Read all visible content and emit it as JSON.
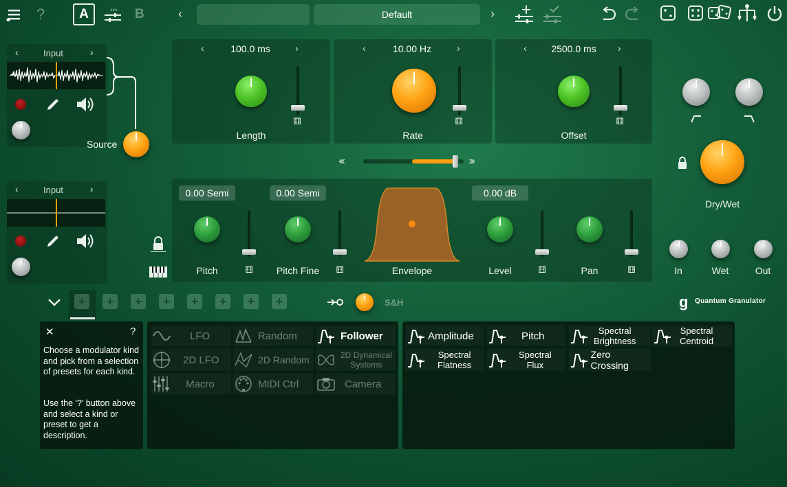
{
  "header": {
    "preset_name": "Default",
    "preset_prev_field": "",
    "ab_a": "A",
    "ab_b": "B",
    "help": "?",
    "nav_prev": "‹",
    "nav_next": "›"
  },
  "source_panel": {
    "input1_label": "Input",
    "input2_label": "Input",
    "source_label": "Source",
    "arrow_left": "‹",
    "arrow_right": "›"
  },
  "grain_controls": {
    "length": {
      "label": "Length",
      "value": "100.0 ms"
    },
    "rate": {
      "label": "Rate",
      "value": "10.00 Hz"
    },
    "offset": {
      "label": "Offset",
      "value": "2500.0 ms"
    }
  },
  "center_slider": {
    "left_glyph": "‹‹‹",
    "right_glyph": "›››",
    "level": 0.92
  },
  "voice_controls": {
    "pitch": {
      "label": "Pitch",
      "value": "0.00 Semi"
    },
    "pitch_fine": {
      "label": "Pitch Fine",
      "value": "0.00 Semi"
    },
    "envelope": {
      "label": "Envelope"
    },
    "level": {
      "label": "Level",
      "value": "0.00 dB"
    },
    "pan": {
      "label": "Pan"
    }
  },
  "output": {
    "dry_wet": "Dry/Wet",
    "in": "In",
    "wet": "Wet",
    "out": "Out"
  },
  "modulator_bar": {
    "sh_label": "S&H",
    "brand": "Quantum Granulator",
    "slot_count": 8
  },
  "help_panel": {
    "close": "✕",
    "help": "?",
    "text1": "Choose a modulator kind and pick from a selection of presets for each kind.",
    "text2": "Use the '?' button above and select a kind or preset to get a description."
  },
  "modulator_kinds": [
    {
      "label": "LFO",
      "icon": "sine-icon",
      "enabled": false
    },
    {
      "label": "Random",
      "icon": "random-icon",
      "enabled": false
    },
    {
      "label": "Follower",
      "icon": "follower-icon",
      "enabled": true
    },
    {
      "label": "2D LFO",
      "icon": "circle-cross-icon",
      "enabled": false
    },
    {
      "label": "2D Random",
      "icon": "random-2d-icon",
      "enabled": false
    },
    {
      "label": "2D Dynamical Systems",
      "line1": "2D Dynamical",
      "line2": "Systems",
      "icon": "butterfly-icon",
      "enabled": false
    },
    {
      "label": "Macro",
      "icon": "macro-icon",
      "enabled": false
    },
    {
      "label": "MIDI Ctrl",
      "icon": "midi-icon",
      "enabled": false
    },
    {
      "label": "Camera",
      "icon": "camera-icon",
      "enabled": false
    }
  ],
  "follower_presets": [
    {
      "label": "Amplitude"
    },
    {
      "label": "Pitch"
    },
    {
      "label": "Spectral Brightness",
      "line1": "Spectral",
      "line2": "Brightness"
    },
    {
      "label": "Spectral Centroid",
      "line1": "Spectral",
      "line2": "Centroid"
    },
    {
      "label": "Spectral Flatness",
      "line1": "Spectral",
      "line2": "Flatness"
    },
    {
      "label": "Spectral Flux",
      "line1": "Spectral",
      "line2": "Flux"
    },
    {
      "label": "Zero Crossing"
    }
  ],
  "colors": {
    "accent_orange": "#ff9e0f",
    "knob_green": "#4ec427",
    "bg_green": "#14603a"
  }
}
